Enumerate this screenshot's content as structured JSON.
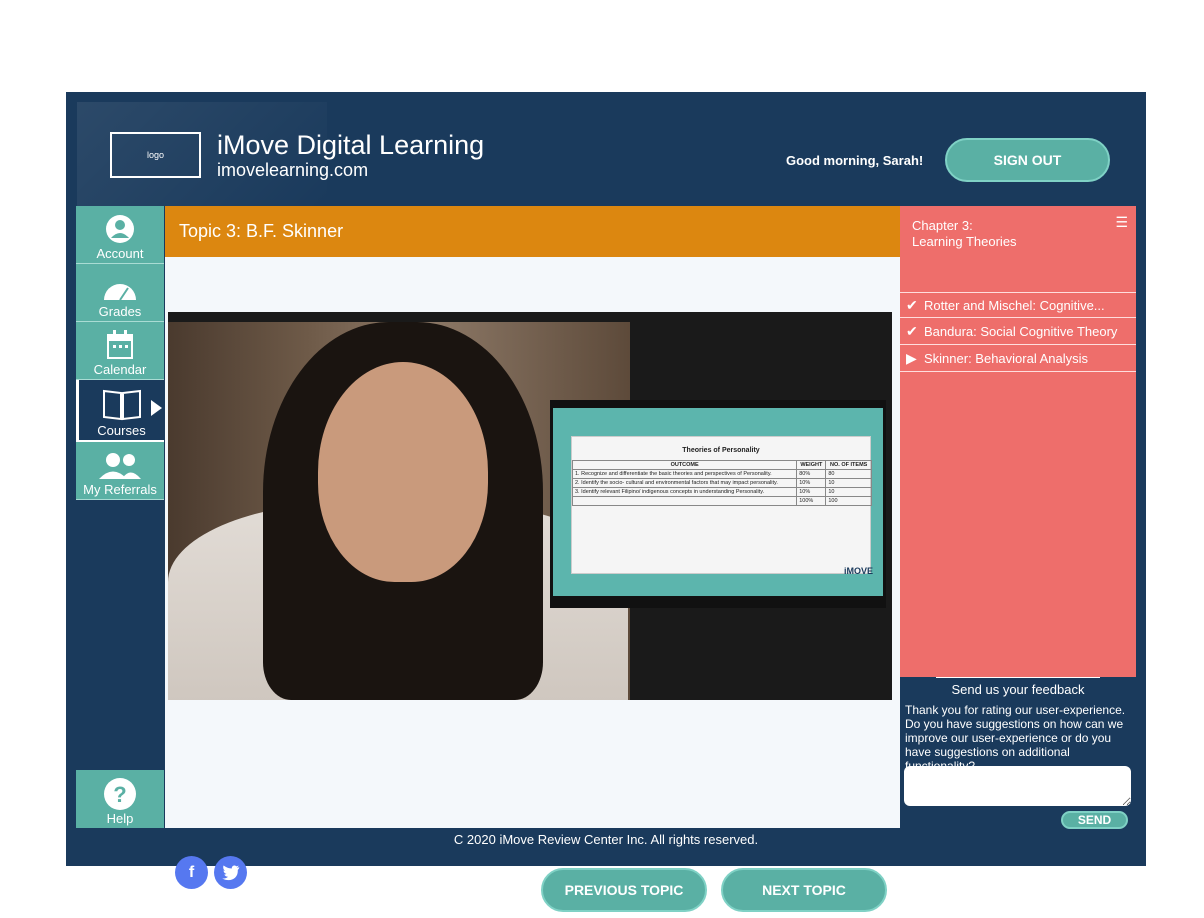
{
  "header": {
    "logo_text": "logo",
    "brand_title": "iMove Digital Learning",
    "brand_url": "imovelearning.com",
    "greeting": "Good morning, Sarah!",
    "signout_label": "SIGN OUT"
  },
  "sidebar": {
    "items": [
      {
        "label": "Account",
        "icon": "user-icon"
      },
      {
        "label": "Grades",
        "icon": "gauge-icon"
      },
      {
        "label": "Calendar",
        "icon": "calendar-icon"
      },
      {
        "label": "Courses",
        "icon": "book-icon"
      },
      {
        "label": "My Referrals",
        "icon": "users-icon"
      }
    ],
    "help_label": "Help"
  },
  "main": {
    "topic_title": "Topic 3: B.F. Skinner",
    "slide": {
      "title": "Theories of Personality",
      "columns": [
        "OUTCOME",
        "WEIGHT",
        "NO. OF ITEMS"
      ],
      "rows": [
        [
          "1.   Recognize and differentiate the basic theories and perspectives of Personality.",
          "80%",
          "80"
        ],
        [
          "2.   Identify the socio- cultural and environmental factors that may impact personality.",
          "10%",
          "10"
        ],
        [
          "3.   Identify relevant Filipino/ indigenous concepts in understanding Personality.",
          "10%",
          "10"
        ],
        [
          "",
          "100%",
          "100"
        ]
      ],
      "brand": "iMOVE"
    },
    "prev_label": "PREVIOUS TOPIC",
    "next_label": "NEXT TOPIC"
  },
  "chapter": {
    "line1": "Chapter 3:",
    "line2": "Learning Theories",
    "lessons": [
      {
        "label": "Rotter and Mischel: Cognitive...",
        "status": "done"
      },
      {
        "label": "Bandura: Social Cognitive Theory",
        "status": "done"
      },
      {
        "label": "Skinner: Behavioral Analysis",
        "status": "current"
      }
    ]
  },
  "feedback": {
    "tab_label": "Send us your feedback",
    "text": "Thank you for rating our user-experience. Do you have suggestions on how can we improve our user-experience or do you have suggestions on additional functionality?",
    "send_label": "SEND"
  },
  "footer": {
    "text": "C 2020 iMove Review Center Inc. All rights reserved."
  },
  "colors": {
    "navy": "#1a3a5c",
    "teal": "#5ab0a4",
    "orange": "#dc8710",
    "coral": "#ee6e6b"
  }
}
